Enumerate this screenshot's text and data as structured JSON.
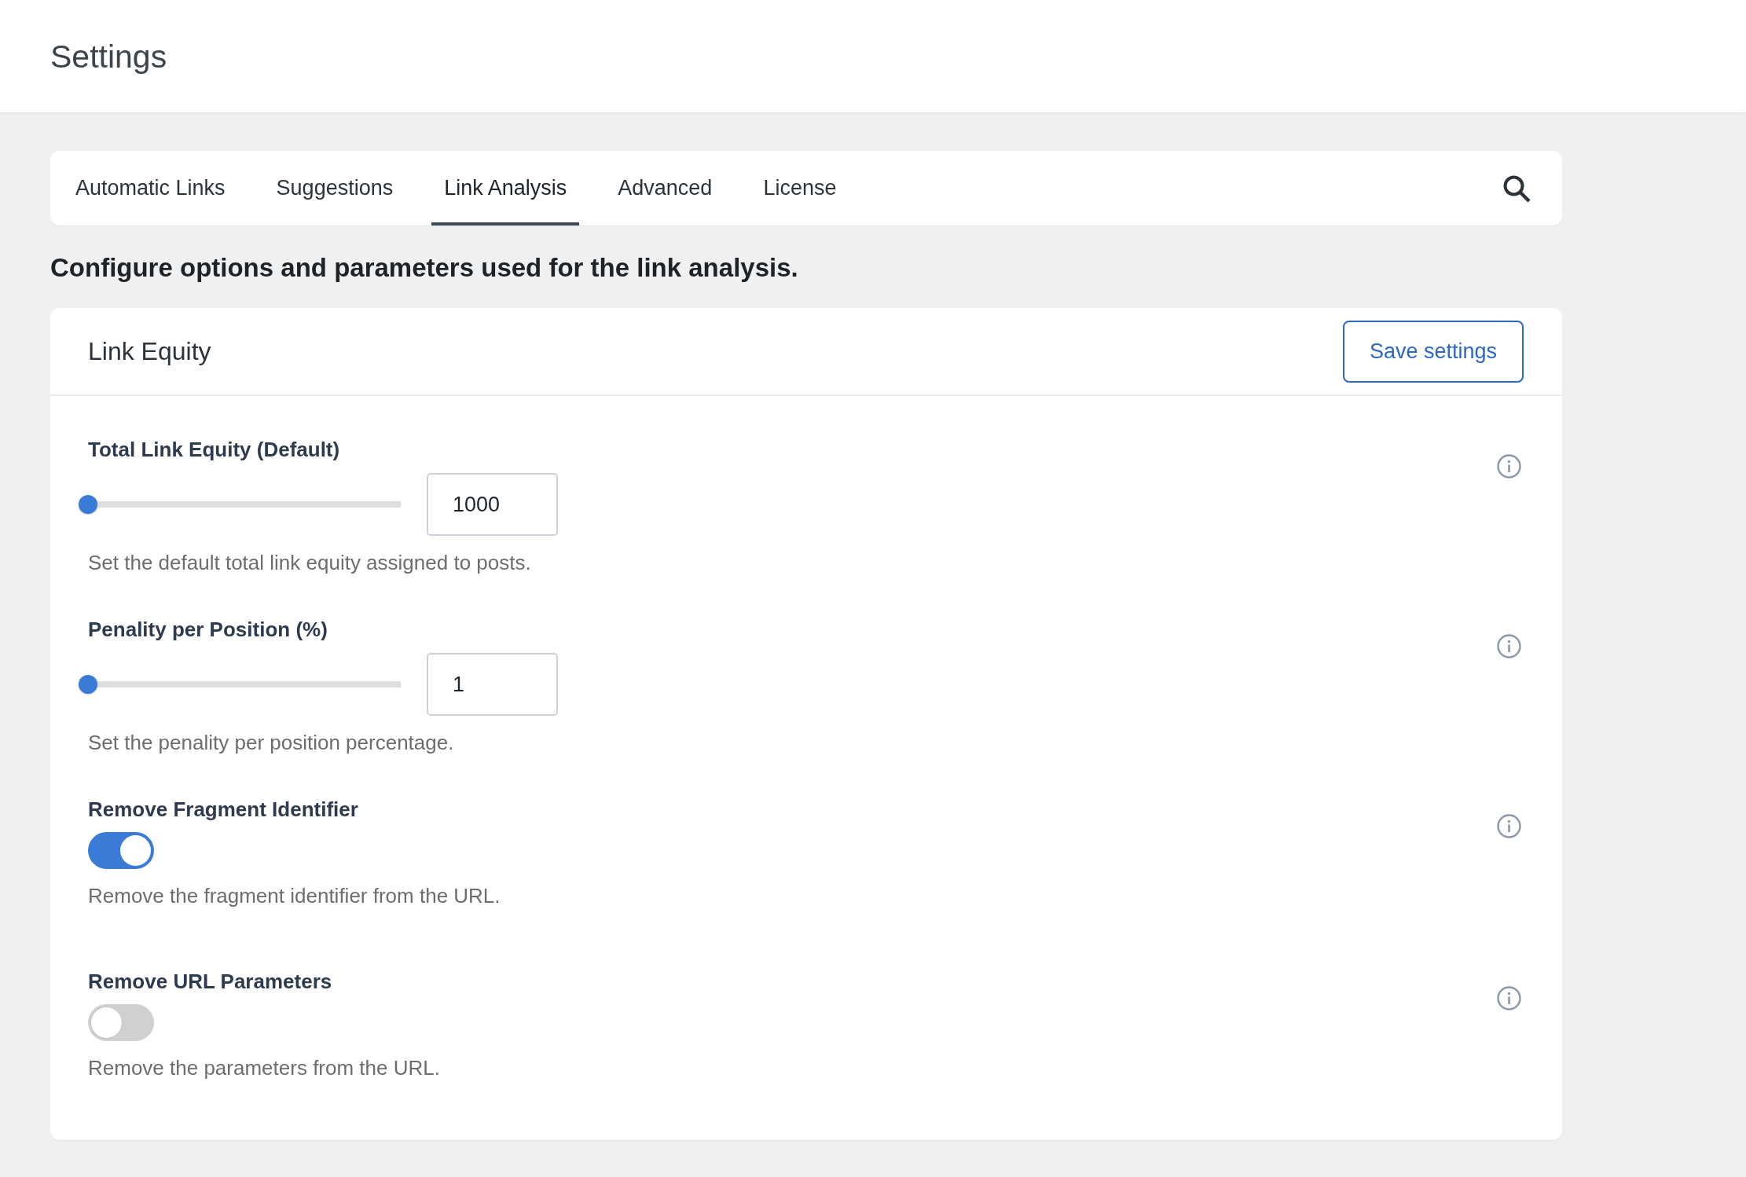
{
  "page": {
    "title": "Settings"
  },
  "tabs": [
    {
      "label": "Automatic Links",
      "selected": false
    },
    {
      "label": "Suggestions",
      "selected": false
    },
    {
      "label": "Link Analysis",
      "selected": true
    },
    {
      "label": "Advanced",
      "selected": false
    },
    {
      "label": "License",
      "selected": false
    }
  ],
  "intro": "Configure options and parameters used for the link analysis.",
  "panel": {
    "title": "Link Equity",
    "save_button": "Save settings",
    "fields": [
      {
        "kind": "slider",
        "label": "Total Link Equity (Default)",
        "level": 0,
        "value": "1000",
        "description": "Set the default total link equity assigned to posts."
      },
      {
        "kind": "slider",
        "label": "Penality per Position (%)",
        "level": 0,
        "value": "1",
        "description": "Set the penality per position percentage."
      },
      {
        "kind": "toggle",
        "label": "Remove Fragment Identifier",
        "on": true,
        "description": "Remove the fragment identifier from the URL."
      },
      {
        "kind": "toggle",
        "label": "Remove URL Parameters",
        "on": false,
        "description": "Remove the parameters from the URL."
      }
    ]
  }
}
